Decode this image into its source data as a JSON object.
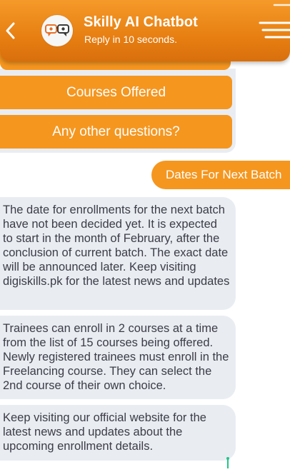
{
  "header": {
    "title": "Skilly AI Chatbot",
    "subtitle": "Reply in 10 seconds."
  },
  "quick_replies": [
    {
      "label": "Courses Offered"
    },
    {
      "label": "Any other questions?"
    }
  ],
  "messages": [
    {
      "sender": "user",
      "text": "Dates For Next Batch"
    },
    {
      "sender": "bot",
      "text": "The date for enrollments for the next batch have not been decided yet. It is expected to start in the month of February, after the conclusion of current batch. The exact date will be announced later. Keep visiting digiskills.pk for the latest news and updates"
    },
    {
      "sender": "bot",
      "text": "Trainees can enroll in 2 courses at a time from the list of 15 courses being offered. Newly registered trainees must enroll in the Freelancing course. They can select the 2nd course of their own choice."
    },
    {
      "sender": "bot",
      "text": "Keep visiting our official website for the latest news and updates about the upcoming enrollment details."
    }
  ],
  "colors": {
    "brand_orange": "#f5961f",
    "bot_bubble": "#e9edf2",
    "header_gradient_top": "#f59a2a",
    "header_gradient_bottom": "#d86f0c"
  },
  "icons": {
    "back": "chevron-left-icon",
    "avatar": "chatbot-avatar-icon",
    "menu": "hamburger-menu-icon"
  }
}
